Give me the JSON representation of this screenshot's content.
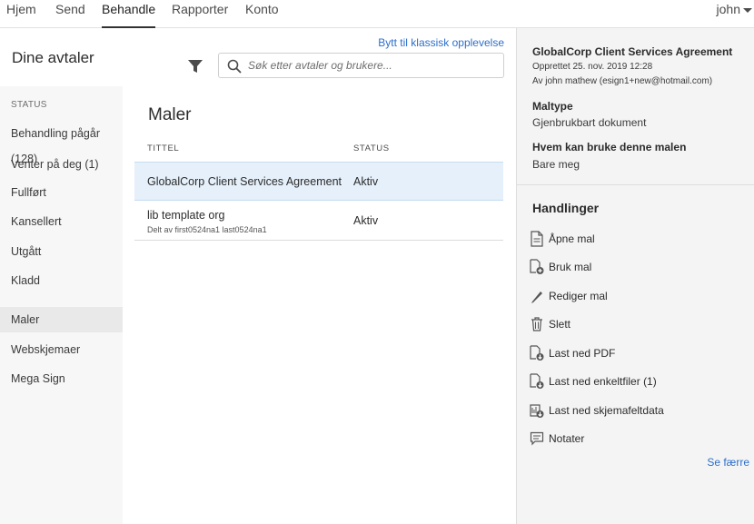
{
  "nav": {
    "tabs": [
      {
        "label": "Hjem"
      },
      {
        "label": "Send"
      },
      {
        "label": "Behandle"
      },
      {
        "label": "Rapporter"
      },
      {
        "label": "Konto"
      }
    ],
    "active_tab": "Behandle",
    "user": "john"
  },
  "header": {
    "title": "Dine avtaler",
    "switch_link": "Bytt til klassisk opplevelse",
    "search_placeholder": "Søk etter avtaler og brukere..."
  },
  "sidebar": {
    "status_heading": "STATUS",
    "items": [
      {
        "label": "Behandling pågår (128)"
      },
      {
        "label": "Venter på deg (1)"
      },
      {
        "label": "Fullført"
      },
      {
        "label": "Kansellert"
      },
      {
        "label": "Utgått"
      },
      {
        "label": "Kladd"
      },
      {
        "label": "Maler"
      },
      {
        "label": "Webskjemaer"
      },
      {
        "label": "Mega Sign"
      }
    ],
    "active_item": "Maler"
  },
  "main": {
    "title": "Maler",
    "columns": {
      "title": "TITTEL",
      "status": "STATUS"
    },
    "rows": [
      {
        "title": "GlobalCorp Client Services Agreement",
        "subtitle": "",
        "status": "Aktiv",
        "selected": true
      },
      {
        "title": "lib template org",
        "subtitle": "Delt av first0524na1 last0524na1",
        "status": "Aktiv",
        "selected": false
      }
    ]
  },
  "details": {
    "title": "GlobalCorp Client Services Agreement",
    "created": "Opprettet 25. nov. 2019 12:28",
    "author": "Av john mathew (esign1+new@hotmail.com)",
    "template_type_label": "Maltype",
    "template_type_value": "Gjenbrukbart dokument",
    "who_can_use_label": "Hvem kan bruke denne malen",
    "who_can_use_value": "Bare meg",
    "actions_heading": "Handlinger",
    "actions": [
      {
        "label": "Åpne mal",
        "icon": "open-document-icon"
      },
      {
        "label": "Bruk mal",
        "icon": "use-template-icon"
      },
      {
        "label": "Rediger mal",
        "icon": "pencil-icon"
      },
      {
        "label": "Slett",
        "icon": "trash-icon"
      },
      {
        "label": "Last ned PDF",
        "icon": "download-pdf-icon"
      },
      {
        "label": "Last ned enkeltfiler (1)",
        "icon": "download-files-icon"
      },
      {
        "label": "Last ned skjemafeltdata",
        "icon": "download-form-data-icon"
      },
      {
        "label": "Notater",
        "icon": "notes-icon"
      }
    ],
    "see_less": "Se færre"
  },
  "colors": {
    "link": "#2d6fcb",
    "selected_row": "#e5f0fa",
    "sidebar_bg": "#f7f7f7",
    "panel_bg": "#f4f4f4"
  }
}
